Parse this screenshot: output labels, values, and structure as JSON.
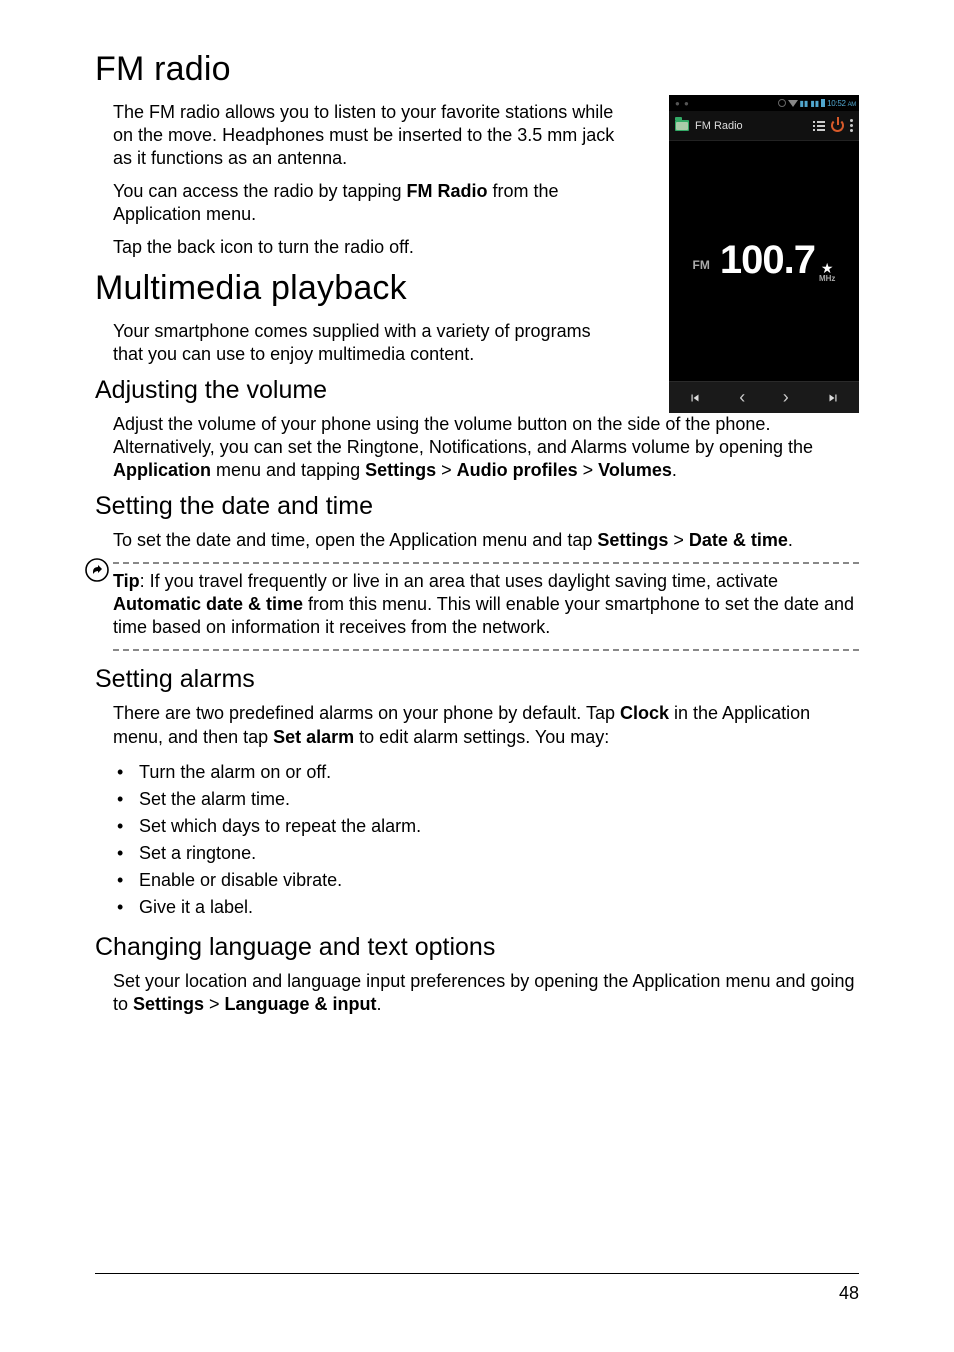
{
  "h1_fm": "FM radio",
  "fm_p1": "The FM radio allows you to listen to your favorite stations while on the move. Headphones must be inserted to the 3.5 mm jack as it functions as an antenna.",
  "fm_p2_pre": "You can access the radio by tapping ",
  "fm_p2_b": "FM Radio",
  "fm_p2_post": " from the Application menu.",
  "fm_p3": "Tap the back icon to turn the radio off.",
  "h1_mm": "Multimedia playback",
  "mm_p1": "Your smartphone comes supplied with a variety of programs that you can use to enjoy multimedia content.",
  "h2_vol": "Adjusting the volume",
  "vol_p1_pre": "Adjust the volume of your phone using the volume button on the side of the phone. Alternatively, you can set the Ringtone, Notifications, and Alarms volume by opening the ",
  "vol_b1": "Application",
  "vol_mid1": " menu and tapping ",
  "vol_b2": "Settings",
  "vol_gt1": " > ",
  "vol_b3": "Audio profiles",
  "vol_gt2": " > ",
  "vol_b4": "Volumes",
  "vol_end": ".",
  "h2_dt": "Setting the date and time",
  "dt_p1_pre": "To set the date and time, open the Application menu and tap ",
  "dt_b1": "Settings",
  "dt_gt": " > ",
  "dt_b2": "Date & time",
  "dt_end": ".",
  "tip_b": "Tip",
  "tip_pre": ": If you travel frequently or live in an area that uses daylight saving time, activate ",
  "tip_b2": "Automatic date & time",
  "tip_post": " from this menu. This will enable your smartphone to set the date and time based on information it receives from the network.",
  "h2_al": "Setting alarms",
  "al_p1_pre": "There are two predefined alarms on your phone by default. Tap ",
  "al_b1": "Clock",
  "al_mid": " in the Application menu, and then tap ",
  "al_b2": "Set alarm",
  "al_post": " to edit alarm settings. You may:",
  "bullets": [
    "Turn the alarm on or off.",
    "Set the alarm time.",
    "Set which days to repeat the alarm.",
    "Set a ringtone.",
    "Enable or disable vibrate.",
    "Give it a label."
  ],
  "h2_lang": "Changing language and text options",
  "lang_p1_pre": "Set your location and language input preferences by opening the Application menu and going to ",
  "lang_b1": "Settings",
  "lang_gt": " > ",
  "lang_b2": "Language & input",
  "lang_end": ".",
  "page_number": "48",
  "phone": {
    "status_time": "10:52",
    "status_ampm": "AM",
    "app_title": "FM Radio",
    "fm_label": "FM",
    "frequency": "100.7",
    "unit": "MHz"
  }
}
